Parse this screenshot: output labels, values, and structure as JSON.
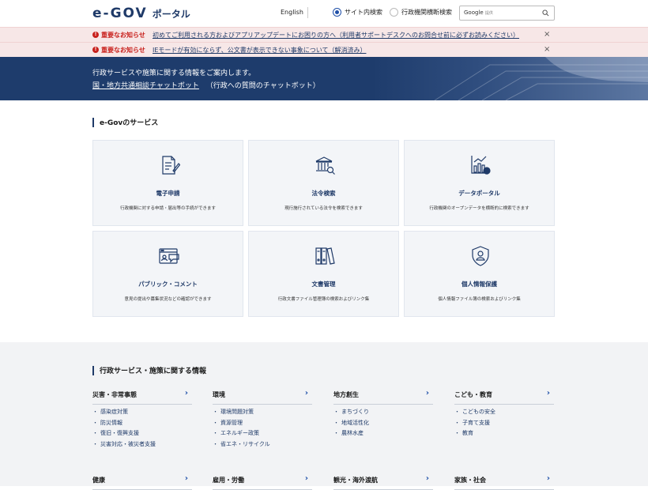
{
  "header": {
    "logo_mark": "e-GOV",
    "logo_portal": "ポータル",
    "english_link": "English",
    "radio_site": "サイト内検索",
    "radio_cross": "行政機関横断検索",
    "search_placeholder": "Google",
    "search_placeholder_small": "提供"
  },
  "notices": [
    {
      "label": "重要なお知らせ",
      "link": "初めてご利用される方およびアプリアップデートにお困りの方へ（利用者サポートデスクへのお問合せ前に必ずお読みください）",
      "close": "×"
    },
    {
      "label": "重要なお知らせ",
      "link": "IEモードが有効にならず、公文書が表示できない事象について（解消済み）",
      "close": "×"
    }
  ],
  "hero": {
    "line1": "行政サービスや施策に関する情報をご案内します。",
    "chatbot_link": "国・地方共通相談チャットボット",
    "chatbot_desc": "（行政への質問のチャットボット）"
  },
  "services": {
    "title": "e-Govのサービス",
    "cards": [
      {
        "title": "電子申請",
        "desc": "行政機関に対する申請・届出等の手続ができます",
        "icon": "document-pen-icon"
      },
      {
        "title": "法令検索",
        "desc": "現行施行されている法令を検索できます",
        "icon": "building-search-icon"
      },
      {
        "title": "データポータル",
        "desc": "行政機関のオープンデータを横断的に検索できます",
        "icon": "chart-icon"
      },
      {
        "title": "パブリック・コメント",
        "desc": "意見の提出や募集状況などの確認ができます",
        "icon": "browser-comment-icon"
      },
      {
        "title": "文書管理",
        "desc": "行政文書ファイル管理簿の検索およびリンク集",
        "icon": "binders-icon"
      },
      {
        "title": "個人情報保護",
        "desc": "個人情報ファイル簿の検索およびリンク集",
        "icon": "shield-person-icon"
      }
    ]
  },
  "policy": {
    "title": "行政サービス・施策に関する情報",
    "categories": [
      {
        "name": "災害・非常事態",
        "items": [
          "感染症対策",
          "防災情報",
          "復旧・復興支援",
          "災害対応・被災者支援"
        ]
      },
      {
        "name": "環境",
        "items": [
          "環境問題対策",
          "資源管理",
          "エネルギー政策",
          "省エネ・リサイクル"
        ]
      },
      {
        "name": "地方創生",
        "items": [
          "まちづくり",
          "地域活性化",
          "農林水産"
        ]
      },
      {
        "name": "こども・教育",
        "items": [
          "こどもの安全",
          "子育て支援",
          "教育"
        ]
      },
      {
        "name": "健康",
        "items": []
      },
      {
        "name": "雇用・労働",
        "items": []
      },
      {
        "name": "観光・海外渡航",
        "items": []
      },
      {
        "name": "家族・社会",
        "items": []
      }
    ],
    "arrow": "›",
    "bullet": "・"
  },
  "colors": {
    "navy": "#1f3a68",
    "notice_red": "#c8201c",
    "notice_bg": "#f7e7e7",
    "hero_bg": "#1e3c6c"
  }
}
